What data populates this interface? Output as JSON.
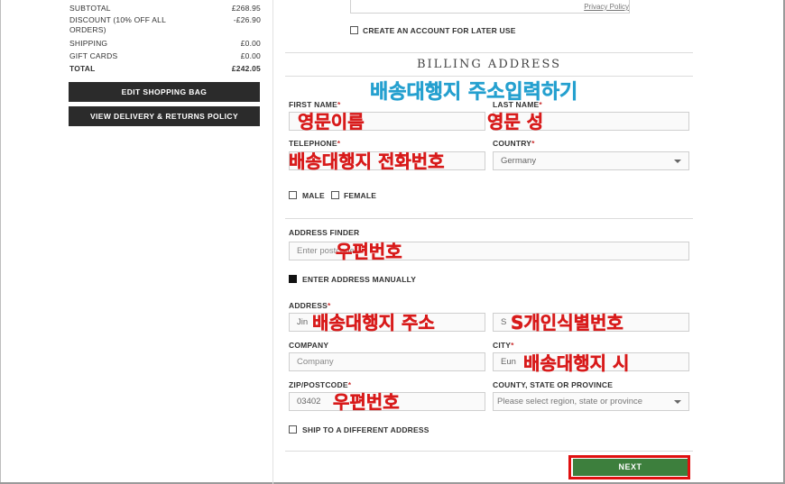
{
  "summary": {
    "rows": [
      {
        "label": "SUBTOTAL",
        "value": "£268.95"
      },
      {
        "label": "DISCOUNT (10% OFF ALL ORDERS)",
        "value": "-£26.90"
      },
      {
        "label": "SHIPPING",
        "value": "£0.00"
      },
      {
        "label": "GIFT CARDS",
        "value": "£0.00"
      },
      {
        "label": "TOTAL",
        "value": "£242.05"
      }
    ],
    "edit_bag_label": "EDIT SHOPPING BAG",
    "delivery_policy_label": "VIEW DELIVERY & RETURNS POLICY"
  },
  "top": {
    "privacy_link": "Privacy Policy",
    "create_account_label": "CREATE AN ACCOUNT FOR LATER USE"
  },
  "billing": {
    "heading": "BILLING ADDRESS",
    "first_name_label": "FIRST NAME",
    "last_name_label": "LAST NAME",
    "telephone_label": "TELEPHONE",
    "country_label": "COUNTRY",
    "country_value": "Germany",
    "male_label": "MALE",
    "female_label": "FEMALE",
    "address_finder_label": "ADDRESS FINDER",
    "address_finder_placeholder": "Enter postcode",
    "enter_manually_label": "ENTER ADDRESS MANUALLY",
    "address_label": "ADDRESS",
    "address_value": "Jin",
    "address2_value": "S",
    "company_label": "COMPANY",
    "company_placeholder": "Company",
    "city_label": "CITY",
    "city_value": "Eun",
    "zip_label": "ZIP/POSTCODE",
    "zip_value": "03402",
    "county_label": "COUNTY, STATE OR PROVINCE",
    "county_placeholder": "Please select region, state or province",
    "ship_different_label": "SHIP TO A DIFFERENT ADDRESS",
    "next_label": "NEXT",
    "required_mark": "*"
  },
  "annotations": {
    "heading_note": "배송대행지 주소입력하기",
    "first_name_note": "영문이름",
    "last_name_note": "영문 성",
    "telephone_note": "배송대행지 전화번호",
    "postcode_note": "우편번호",
    "address_note": "배송대행지 주소",
    "address2_note": "S개인식별번호",
    "city_note": "배송대행지 시",
    "zip_note": "우편번호"
  },
  "colors": {
    "annotation_blue": "#25a0cf",
    "annotation_red": "#d81b1b",
    "next_button": "#3d7f3d",
    "highlight_outline": "#e01010"
  }
}
